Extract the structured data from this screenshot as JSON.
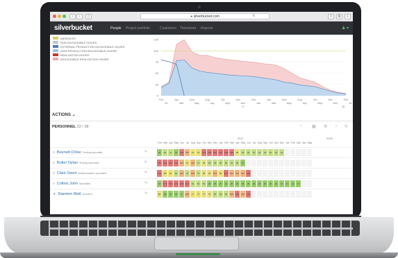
{
  "browser": {
    "url": "silverbucket.com"
  },
  "app": {
    "brand": "silverbucket",
    "nav": [
      "People",
      "Project portfolio",
      "Customers",
      "Timesheet",
      "Reports"
    ]
  },
  "legend": [
    {
      "label": "Absences",
      "color": "#d8d066"
    },
    {
      "label": "Non invoiceable hours",
      "color": "#b9c7d6"
    },
    {
      "label": "External production invoiceable hours",
      "color": "#4f7fb8"
    },
    {
      "label": "Own production invoiceable hours",
      "color": "#9ec3e6"
    },
    {
      "label": "Realization hours",
      "color": "#c0392b"
    },
    {
      "label": "Invoiceable realization hours",
      "color": "#f0a9a9"
    }
  ],
  "chart_data": {
    "type": "area",
    "yticks": [
      "125",
      "100",
      "75",
      "50",
      "25",
      "0"
    ],
    "ylim": [
      0,
      130
    ],
    "reference_line": 100,
    "x": [
      "Feb 16",
      "Mar",
      "Apr",
      "May",
      "June",
      "July",
      "Aug",
      "Sept",
      "Oct",
      "Nov",
      "Dec",
      "Jan 17",
      "Feb",
      "Mar",
      "Apr",
      "May",
      "June",
      "July",
      "Aug",
      "Sept",
      "Oct",
      "Nov",
      "Dec",
      "Jan 18",
      "Feb"
    ],
    "xtick_top": [
      "Feb",
      "Apr",
      "June",
      "Aug",
      "Oct",
      "Dec",
      "Feb",
      "Apr",
      "June",
      "Aug",
      "Oct",
      "Dec",
      "Feb"
    ],
    "xtick_bottom": [
      "16",
      "Mar",
      "May",
      "July",
      "Sept",
      "Nov",
      "Jan",
      "Mar",
      "May",
      "July",
      "Sept",
      "Nov",
      "Jan"
    ],
    "year_labels": [
      "17",
      "18"
    ],
    "series": [
      {
        "name": "Invoiceable realization hours",
        "values": [
          20,
          30,
          115,
          125,
          98,
          90,
          90,
          85,
          82,
          80,
          78,
          76,
          75,
          72,
          70,
          68,
          60,
          50,
          40,
          35,
          30,
          20,
          12,
          8,
          5
        ]
      },
      {
        "name": "Own production invoiceable hours",
        "values": [
          18,
          28,
          78,
          80,
          62,
          55,
          52,
          50,
          48,
          46,
          45,
          44,
          43,
          40,
          38,
          35,
          30,
          28,
          24,
          22,
          20,
          15,
          10,
          6,
          4
        ]
      },
      {
        "name": "Realization hours",
        "values": [
          80,
          76,
          70,
          0,
          null,
          null,
          null,
          null,
          null,
          null,
          null,
          null,
          null,
          null,
          null,
          null,
          null,
          null,
          null,
          null,
          null,
          null,
          null,
          null,
          null
        ]
      }
    ]
  },
  "actions_label": "ACTIONS",
  "personnel": {
    "label": "PERSONNEL",
    "count": "22 / 28"
  },
  "years": [
    "2017",
    "2018"
  ],
  "months": [
    "Feb",
    "Mar",
    "Apr",
    "May",
    "Jun",
    "Jul",
    "Aug",
    "Sep",
    "Oct",
    "Nov",
    "Dec",
    "Jan",
    "Feb",
    "Mar",
    "Apr",
    "May",
    "Jun",
    "Jul",
    "Aug",
    "Sep",
    "Oct",
    "Nov",
    "Dec",
    "Jan",
    "Feb",
    "Mar",
    "Apr",
    "May"
  ],
  "people": [
    {
      "name": "Beenett Chloe",
      "role": "Testing specialist",
      "icon": "list-icon",
      "cells": [
        "32",
        "62",
        "41",
        "37",
        "134",
        "113",
        "75",
        "75",
        "140",
        "140",
        "140",
        "140",
        "140",
        "140",
        "80",
        "63",
        "43",
        "43",
        "44",
        "43",
        "42",
        "43",
        "42",
        "",
        "",
        " ",
        " ",
        " "
      ]
    },
    {
      "name": "Butler Dylan",
      "role": "Testing specialist",
      "icon": "list-icon",
      "cells": [
        "181",
        "142",
        "160",
        "123",
        "118",
        "97",
        "110",
        "71",
        "96",
        "69",
        "40",
        "60",
        "50",
        "43",
        "55",
        "12",
        "",
        "",
        "",
        "",
        "",
        "",
        "",
        "",
        "",
        "",
        "",
        ""
      ]
    },
    {
      "name": "Clark Owen",
      "role": "Modernization specialist",
      "icon": "list-icon",
      "cells": [
        "144",
        "80",
        "91",
        "62",
        "107",
        "70",
        "100",
        "71",
        "86",
        "91",
        "101",
        "89",
        "121",
        "101",
        "113",
        "107",
        "140",
        "",
        "",
        "",
        "",
        "",
        "",
        "",
        "",
        "",
        "",
        ""
      ]
    },
    {
      "name": "Collins John",
      "role": "Specialist",
      "icon": "list-icon",
      "cells": [
        "18",
        "177",
        "140",
        "140",
        "140",
        "140",
        "54",
        "54",
        "54",
        "20",
        "20",
        "20",
        "20",
        "20",
        "20",
        "20",
        "20",
        "20",
        "20",
        "20",
        "20",
        "22",
        "17",
        "17",
        "12",
        "10",
        "",
        ""
      ]
    },
    {
      "name": "Daemon Matt",
      "role": "Architect",
      "icon": "star-icon",
      "cells": [
        "80",
        "38",
        "30",
        "24",
        "8",
        "105",
        "77",
        "77",
        "77",
        "75",
        "60",
        "48",
        "60",
        "100",
        "140",
        "100",
        "140",
        "",
        "",
        "",
        "",
        "",
        "",
        "",
        "",
        "",
        "",
        ""
      ]
    }
  ],
  "colors": {
    "red": "#e07a7a",
    "orange": "#f0b47a",
    "yellow": "#e8e07a",
    "lightgreen": "#c5dc8a",
    "green": "#9ccb6e",
    "blank": "#f3f3f3"
  }
}
